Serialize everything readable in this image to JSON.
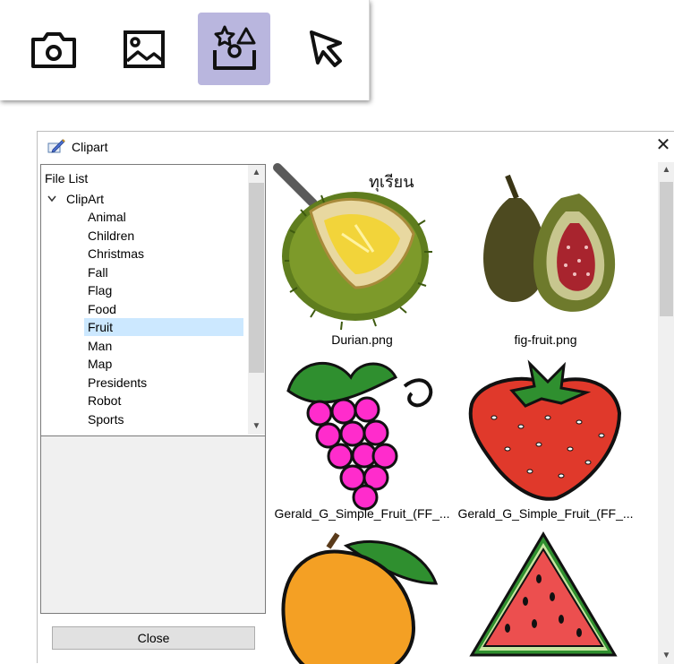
{
  "toolbar": {
    "buttons": [
      {
        "icon": "camera-icon"
      },
      {
        "icon": "image-icon"
      },
      {
        "icon": "clipart-icon",
        "active": true
      },
      {
        "icon": "pointer-icon"
      }
    ],
    "active_color": "#b9b6de"
  },
  "dialog": {
    "title": "Clipart",
    "close_glyph": "✕",
    "tree": {
      "header": "File List",
      "root": "ClipArt",
      "items": [
        "Animal",
        "Children",
        "Christmas",
        "Fall",
        "Flag",
        "Food",
        "Fruit",
        "Man",
        "Map",
        "Presidents",
        "Robot",
        "Sports"
      ],
      "selected": "Fruit"
    },
    "close_button": "Close",
    "files": [
      {
        "name": "Durian.png",
        "art": "durian"
      },
      {
        "name": "fig-fruit.png",
        "art": "fig"
      },
      {
        "name": "Gerald_G_Simple_Fruit_(FF_...",
        "art": "grapes"
      },
      {
        "name": "Gerald_G_Simple_Fruit_(FF_...",
        "art": "strawberry"
      },
      {
        "name": "",
        "art": "peach"
      },
      {
        "name": "",
        "art": "watermelon"
      }
    ],
    "durian_caption": "ทุเรียน",
    "selection_color": "#cce8ff"
  }
}
